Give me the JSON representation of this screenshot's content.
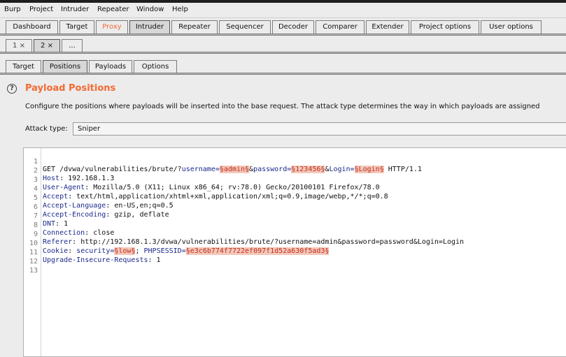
{
  "menu": [
    "Burp",
    "Project",
    "Intruder",
    "Repeater",
    "Window",
    "Help"
  ],
  "main_tabs": [
    "Dashboard",
    "Target",
    "Proxy",
    "Intruder",
    "Repeater",
    "Sequencer",
    "Decoder",
    "Comparer",
    "Extender",
    "Project options",
    "User options"
  ],
  "attack_tabs": [
    "1 ×",
    "2 ×",
    "..."
  ],
  "sub_tabs": [
    "Target",
    "Positions",
    "Payloads",
    "Options"
  ],
  "panel": {
    "title": "Payload Positions",
    "description": "Configure the positions where payloads will be inserted into the base request. The attack type determines the way in which payloads are assigned",
    "attack_type_label": "Attack type:",
    "attack_type_value": "Sniper"
  },
  "colors": {
    "accent": "#f26b33",
    "payload_bg": "#f3c8bb",
    "header_key": "#1c2a8a"
  },
  "request": {
    "line_numbers": [
      "1",
      "2",
      "3",
      "4",
      "5",
      "6",
      "7",
      "8",
      "9",
      "10",
      "11",
      "12",
      "13"
    ],
    "line1": {
      "a": "GET /dvwa/vulnerabilities/brute/?",
      "k1": "username=",
      "p1": "§admin§",
      "amp1": "&",
      "k2": "password=",
      "p2": "§123456§",
      "amp2": "&",
      "k3": "Login=",
      "p3": "§Login§",
      "b": " HTTP/1.1"
    },
    "headers": [
      {
        "key": "Host",
        "value": ": 192.168.1.3"
      },
      {
        "key": "User-Agent",
        "value": ": Mozilla/5.0 (X11; Linux x86_64; rv:78.0) Gecko/20100101 Firefox/78.0"
      },
      {
        "key": "Accept",
        "value": ": text/html,application/xhtml+xml,application/xml;q=0.9,image/webp,*/*;q=0.8"
      },
      {
        "key": "Accept-Language",
        "value": ": en-US,en;q=0.5"
      },
      {
        "key": "Accept-Encoding",
        "value": ": gzip, deflate"
      },
      {
        "key": "DNT",
        "value": ": 1"
      },
      {
        "key": "Connection",
        "value": ": close"
      },
      {
        "key": "Referer",
        "value": ": http://192.168.1.3/dvwa/vulnerabilities/brute/?username=admin&password=password&Login=Login"
      }
    ],
    "cookie": {
      "key": "Cookie",
      "sep": ": ",
      "c1k": "security=",
      "c1v": "§low§",
      "sep2": "; ",
      "c2k": "PHPSESSID=",
      "c2v": "§e3c6b774f7722ef097f1d52a630f5ad3§"
    },
    "last_header": {
      "key": "Upgrade-Insecure-Requests",
      "value": ": 1"
    }
  }
}
